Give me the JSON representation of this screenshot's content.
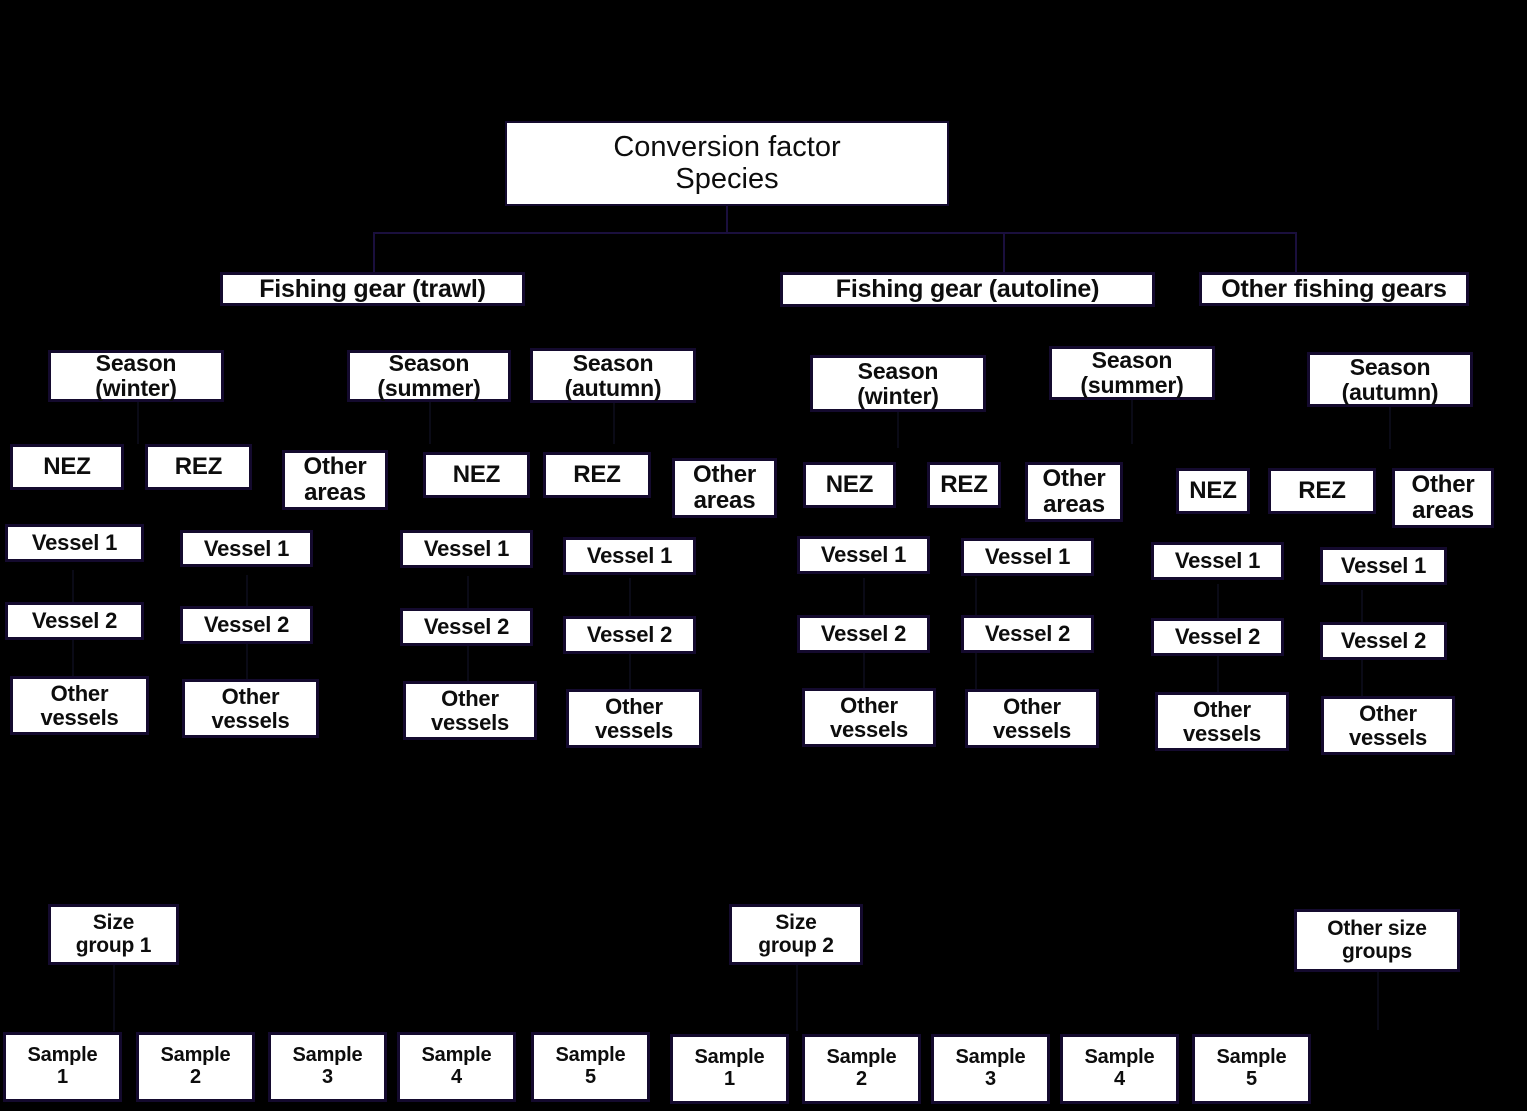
{
  "diagram": {
    "title": "Conversion factor sampling hierarchy",
    "background_color": "#000000",
    "box_fill_color": "#ffffff",
    "box_border_color": "#140a2e",
    "connector_color": "#1a0f3d",
    "text_color": "#0d0d0d"
  },
  "root": {
    "label": "Conversion factor\nSpecies"
  },
  "gears": [
    {
      "label": "Fishing gear (trawl)"
    },
    {
      "label": "Fishing gear (autoline)"
    },
    {
      "label": "Other fishing gears"
    }
  ],
  "seasons": [
    {
      "label": "Season\n(winter)"
    },
    {
      "label": "Season\n(summer)"
    },
    {
      "label": "Season\n(autumn)"
    },
    {
      "label": "Season\n(winter)"
    },
    {
      "label": "Season\n(summer)"
    },
    {
      "label": "Season\n(autumn)"
    }
  ],
  "areas": [
    {
      "label": "NEZ"
    },
    {
      "label": "REZ"
    },
    {
      "label": "Other\nareas"
    },
    {
      "label": "NEZ"
    },
    {
      "label": "REZ"
    },
    {
      "label": "Other\nareas"
    },
    {
      "label": "NEZ"
    },
    {
      "label": "REZ"
    },
    {
      "label": "Other\nareas"
    },
    {
      "label": "NEZ"
    },
    {
      "label": "REZ"
    },
    {
      "label": "Other\nareas"
    }
  ],
  "vessels1": [
    {
      "label": "Vessel 1"
    },
    {
      "label": "Vessel 1"
    },
    {
      "label": "Vessel 1"
    },
    {
      "label": "Vessel 1"
    },
    {
      "label": "Vessel 1"
    },
    {
      "label": "Vessel 1"
    },
    {
      "label": "Vessel 1"
    },
    {
      "label": "Vessel 1"
    }
  ],
  "vessels2": [
    {
      "label": "Vessel 2"
    },
    {
      "label": "Vessel 2"
    },
    {
      "label": "Vessel 2"
    },
    {
      "label": "Vessel 2"
    },
    {
      "label": "Vessel 2"
    },
    {
      "label": "Vessel 2"
    },
    {
      "label": "Vessel 2"
    },
    {
      "label": "Vessel 2"
    }
  ],
  "other_vessels": [
    {
      "label": "Other\nvessels"
    },
    {
      "label": "Other\nvessels"
    },
    {
      "label": "Other\nvessels"
    },
    {
      "label": "Other\nvessels"
    },
    {
      "label": "Other\nvessels"
    },
    {
      "label": "Other\nvessels"
    },
    {
      "label": "Other\nvessels"
    },
    {
      "label": "Other\nvessels"
    }
  ],
  "size_groups": [
    {
      "label": "Size\ngroup 1"
    },
    {
      "label": "Size\ngroup 2"
    },
    {
      "label": "Other size\ngroups"
    }
  ],
  "samples": [
    {
      "label": "Sample\n1"
    },
    {
      "label": "Sample\n2"
    },
    {
      "label": "Sample\n3"
    },
    {
      "label": "Sample\n4"
    },
    {
      "label": "Sample\n5"
    },
    {
      "label": "Sample\n1"
    },
    {
      "label": "Sample\n2"
    },
    {
      "label": "Sample\n3"
    },
    {
      "label": "Sample\n4"
    },
    {
      "label": "Sample\n5"
    }
  ]
}
